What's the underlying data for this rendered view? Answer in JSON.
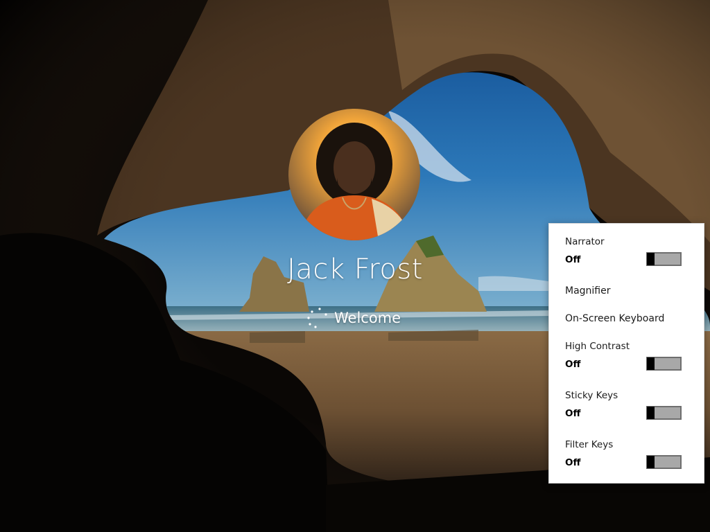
{
  "user": {
    "name": "Jack Frost",
    "status": "Welcome",
    "avatar_icon": "user-avatar-portrait"
  },
  "ease_of_access": {
    "narrator": {
      "label": "Narrator",
      "state": "Off",
      "on": false
    },
    "magnifier": {
      "label": "Magnifier"
    },
    "on_screen_keyboard": {
      "label": "On-Screen Keyboard"
    },
    "high_contrast": {
      "label": "High Contrast",
      "state": "Off",
      "on": false
    },
    "sticky_keys": {
      "label": "Sticky Keys",
      "state": "Off",
      "on": false
    },
    "filter_keys": {
      "label": "Filter Keys",
      "state": "Off",
      "on": false
    }
  },
  "colors": {
    "panel_bg": "#ffffff",
    "toggle_off_track": "#a8a8a8",
    "toggle_thumb": "#000000",
    "text_on_wallpaper": "#ffffff"
  }
}
